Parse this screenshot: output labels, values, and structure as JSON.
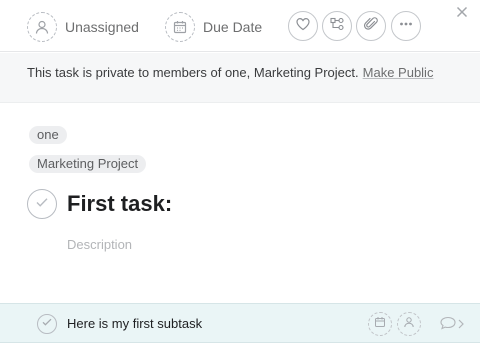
{
  "toolbar": {
    "assignee_label": "Unassigned",
    "due_date_label": "Due Date",
    "icons": [
      "user-icon",
      "calendar-icon",
      "heart-icon",
      "subtasks-icon",
      "paperclip-icon",
      "more-icon",
      "close-icon"
    ]
  },
  "privacy": {
    "message": "This task is private to members of one, Marketing Project.",
    "link": "Make Public"
  },
  "tags": [
    "one",
    "Marketing Project"
  ],
  "task": {
    "title": "First task:",
    "description_placeholder": "Description"
  },
  "subtask": {
    "label": "Here is my first subtask",
    "icons": [
      "calendar-icon",
      "user-icon",
      "comment-icon",
      "chevron-right-icon"
    ]
  },
  "colors": {
    "subtask_bg": "#eaf5f6",
    "privacy_bg": "#f6f7f8",
    "icon_border": "#b8bcc2"
  }
}
